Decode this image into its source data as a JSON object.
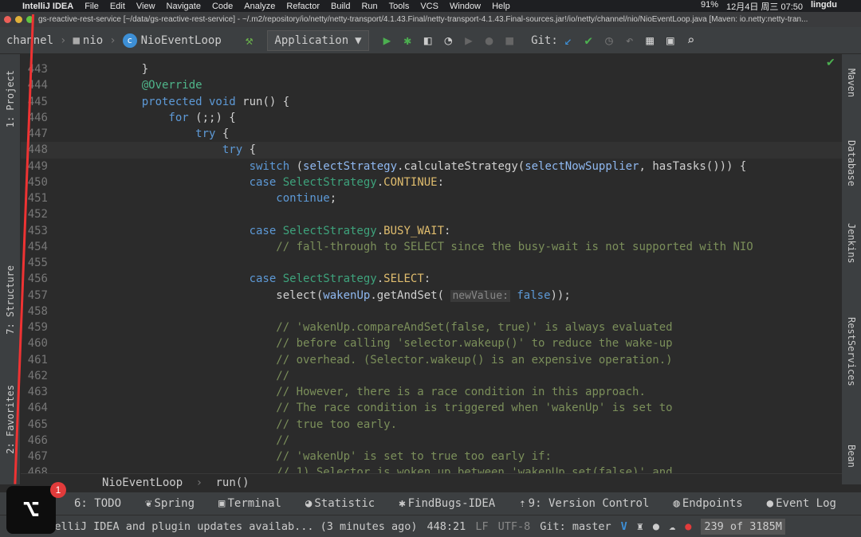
{
  "menubar": {
    "app": "IntelliJ IDEA",
    "items": [
      "File",
      "Edit",
      "View",
      "Navigate",
      "Code",
      "Analyze",
      "Refactor",
      "Build",
      "Run",
      "Tools",
      "VCS",
      "Window",
      "Help"
    ],
    "battery": "91%",
    "date": "12月4日 周三 07:50",
    "user": "lingdu"
  },
  "title": "gs-reactive-rest-service [~/data/gs-reactive-rest-service] - ~/.m2/repository/io/netty/netty-transport/4.1.43.Final/netty-transport-4.1.43.Final-sources.jar!/io/netty/channel/nio/NioEventLoop.java [Maven: io.netty:netty-tran...",
  "toolbar": {
    "breadcrumb": [
      "channel",
      "nio",
      "NioEventLoop"
    ],
    "run_config": "Application",
    "git_label": "Git:"
  },
  "left_tools": [
    "1: Project",
    "7: Structure",
    "2: Favorites"
  ],
  "right_tools": [
    "Maven",
    "Database",
    "Jenkins",
    "RestServices",
    "Bean"
  ],
  "code": {
    "current_line": 448,
    "lines": [
      {
        "n": "443",
        "t": [
          [
            "pl",
            "    }"
          ]
        ]
      },
      {
        "n": "444",
        "t": [
          [
            "an",
            "    @Override"
          ]
        ]
      },
      {
        "n": "445",
        "t": [
          [
            "kw",
            "    protected void "
          ],
          [
            "pl",
            "run() {"
          ]
        ]
      },
      {
        "n": "446",
        "t": [
          [
            "kw",
            "        for "
          ],
          [
            "pl",
            "(;;) {"
          ]
        ]
      },
      {
        "n": "447",
        "t": [
          [
            "kw",
            "            try "
          ],
          [
            "pl",
            "{"
          ]
        ]
      },
      {
        "n": "448",
        "t": [
          [
            "kw",
            "                try "
          ],
          [
            "pl",
            "{"
          ]
        ]
      },
      {
        "n": "449",
        "t": [
          [
            "kw",
            "                    switch "
          ],
          [
            "pl",
            "("
          ],
          [
            "fd",
            "selectStrategy"
          ],
          [
            "pl",
            ".calculateStrategy("
          ],
          [
            "fd",
            "selectNowSupplier"
          ],
          [
            "pl",
            ", hasTasks())) {"
          ]
        ]
      },
      {
        "n": "450",
        "t": [
          [
            "kw",
            "                    case "
          ],
          [
            "cl",
            "SelectStrategy"
          ],
          [
            "pl",
            "."
          ],
          [
            "cn",
            "CONTINUE"
          ],
          [
            "pl",
            ":"
          ]
        ]
      },
      {
        "n": "451",
        "t": [
          [
            "kw",
            "                        continue"
          ],
          [
            "pl",
            ";"
          ]
        ]
      },
      {
        "n": "452",
        "t": []
      },
      {
        "n": "453",
        "t": [
          [
            "kw",
            "                    case "
          ],
          [
            "cl",
            "SelectStrategy"
          ],
          [
            "pl",
            "."
          ],
          [
            "cn",
            "BUSY_WAIT"
          ],
          [
            "pl",
            ":"
          ]
        ]
      },
      {
        "n": "454",
        "t": [
          [
            "cm",
            "                        // fall-through to SELECT since the busy-wait is not supported with NIO"
          ]
        ]
      },
      {
        "n": "455",
        "t": []
      },
      {
        "n": "456",
        "t": [
          [
            "kw",
            "                    case "
          ],
          [
            "cl",
            "SelectStrategy"
          ],
          [
            "pl",
            "."
          ],
          [
            "cn",
            "SELECT"
          ],
          [
            "pl",
            ":"
          ]
        ]
      },
      {
        "n": "457",
        "t": [
          [
            "pl",
            "                        select("
          ],
          [
            "fd",
            "wakenUp"
          ],
          [
            "pl",
            ".getAndSet( "
          ],
          [
            "hint",
            "newValue:"
          ],
          [
            "kw",
            " false"
          ],
          [
            "pl",
            "));"
          ]
        ]
      },
      {
        "n": "458",
        "t": []
      },
      {
        "n": "459",
        "t": [
          [
            "cm",
            "                        // 'wakenUp.compareAndSet(false, true)' is always evaluated"
          ]
        ]
      },
      {
        "n": "460",
        "t": [
          [
            "cm",
            "                        // before calling 'selector.wakeup()' to reduce the wake-up"
          ]
        ]
      },
      {
        "n": "461",
        "t": [
          [
            "cm",
            "                        // overhead. (Selector.wakeup() is an expensive operation.)"
          ]
        ]
      },
      {
        "n": "462",
        "t": [
          [
            "cm",
            "                        //"
          ]
        ]
      },
      {
        "n": "463",
        "t": [
          [
            "cm",
            "                        // However, there is a race condition in this approach."
          ]
        ]
      },
      {
        "n": "464",
        "t": [
          [
            "cm",
            "                        // The race condition is triggered when 'wakenUp' is set to"
          ]
        ]
      },
      {
        "n": "465",
        "t": [
          [
            "cm",
            "                        // true too early."
          ]
        ]
      },
      {
        "n": "466",
        "t": [
          [
            "cm",
            "                        //"
          ]
        ]
      },
      {
        "n": "467",
        "t": [
          [
            "cm",
            "                        // 'wakenUp' is set to true too early if:"
          ]
        ]
      },
      {
        "n": "468",
        "t": [
          [
            "cm",
            "                        // 1) Selector is woken up between 'wakenUp.set(false)' and"
          ]
        ]
      }
    ]
  },
  "editor_breadcrumb": [
    "NioEventLoop",
    "run()"
  ],
  "tool_windows": [
    "6: TODO",
    "Spring",
    "Terminal",
    "Statistic",
    "FindBugs-IDEA",
    "9: Version Control",
    "Endpoints",
    "Event Log"
  ],
  "status": {
    "message": "IntelliJ IDEA and plugin updates availab... (3 minutes ago)",
    "position": "448:21",
    "line_sep": "LF",
    "encoding": "UTF-8",
    "git": "Git: master",
    "memory": "239 of 3185M"
  },
  "notification_count": "1",
  "colors": {
    "background": "#2b2b2b",
    "keyword": "#5d99d6",
    "comment": "#7b8f5a",
    "constant": "#e0bd6e"
  }
}
